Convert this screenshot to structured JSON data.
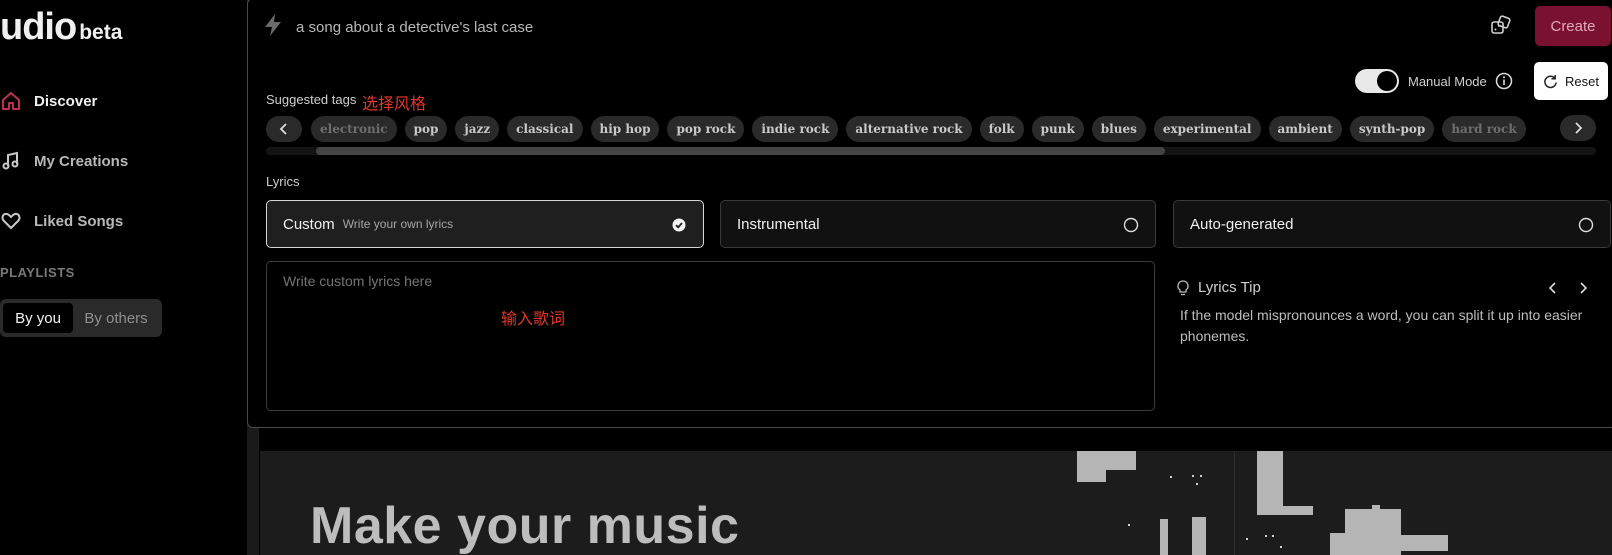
{
  "brand": {
    "name": "udio",
    "badge": "beta"
  },
  "sidebar": {
    "items": [
      {
        "label": "Discover",
        "icon": "home-icon",
        "active": true
      },
      {
        "label": "My Creations",
        "icon": "music-note-icon",
        "active": false
      },
      {
        "label": "Liked Songs",
        "icon": "heart-icon",
        "active": false
      }
    ],
    "playlists_title": "PLAYLISTS",
    "playlist_filter": {
      "selected": "By you",
      "other": "By others"
    }
  },
  "prompt": {
    "value": "a song about a detective's last case",
    "icon": "lightning-icon"
  },
  "toolbar": {
    "create_label": "Create",
    "manual_mode_label": "Manual Mode",
    "manual_mode_on": true,
    "reset_label": "Reset"
  },
  "tags": {
    "label": "Suggested tags",
    "annotation": "选择风格",
    "items": [
      "electronic",
      "pop",
      "jazz",
      "classical",
      "hip hop",
      "pop rock",
      "indie rock",
      "alternative rock",
      "folk",
      "punk",
      "blues",
      "experimental",
      "ambient",
      "synth-pop",
      "hard rock"
    ]
  },
  "lyrics": {
    "label": "Lyrics",
    "options": [
      {
        "title": "Custom",
        "subtitle": "Write your own lyrics",
        "selected": true
      },
      {
        "title": "Instrumental",
        "selected": false
      },
      {
        "title": "Auto-generated",
        "selected": false
      }
    ],
    "placeholder": "Write custom lyrics here",
    "annotation": "输入歌词",
    "tip_title": "Lyrics Tip",
    "tip_text": "If the model mispronounces a word, you can split it up into easier phonemes."
  },
  "banner": {
    "title": "Make your music"
  },
  "colors": {
    "accent": "#7a1130",
    "annotation": "#e0382a",
    "background": "#000000"
  }
}
